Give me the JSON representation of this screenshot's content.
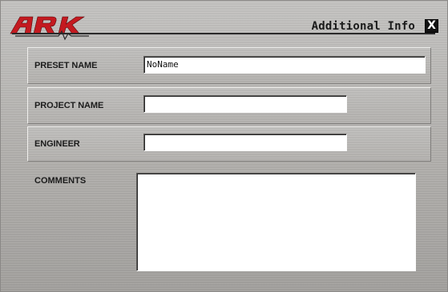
{
  "brand": {
    "logo_text": "ARK",
    "logo_color": "#c41a20"
  },
  "header": {
    "title": "Additional Info",
    "close_label": "X"
  },
  "form": {
    "preset_name": {
      "label": "PRESET NAME",
      "value": "NoName"
    },
    "project_name": {
      "label": "PROJECT NAME",
      "value": ""
    },
    "engineer": {
      "label": "ENGINEER",
      "value": ""
    },
    "comments": {
      "label": "COMMENTS",
      "value": ""
    }
  }
}
